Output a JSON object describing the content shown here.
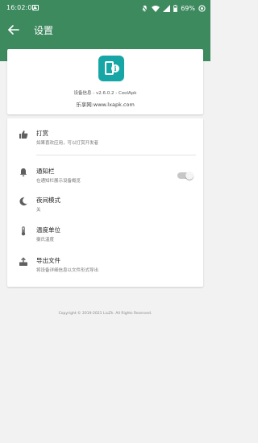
{
  "status_bar": {
    "time": "16:02:07",
    "battery": "69%",
    "icons": [
      "image-icon",
      "bell-off-icon",
      "wifi-icon",
      "signal-icon",
      "battery-icon",
      "sync-icon"
    ]
  },
  "app_bar": {
    "title": "设置",
    "back_icon": "arrow-left-icon"
  },
  "header": {
    "version": "设备信息 - v2.6.0.2 - CoolApk",
    "site": "乐享网:www.lxapk.com"
  },
  "settings": [
    {
      "title": "打赏",
      "subtitle": "如果喜欢应用，可以打赏开发者",
      "icon": "thumb-up-icon"
    },
    {
      "title": "通知栏",
      "subtitle": "在通知栏展示设备概览",
      "icon": "bell-icon",
      "toggle": false
    },
    {
      "title": "夜间模式",
      "subtitle": "关",
      "icon": "moon-icon"
    },
    {
      "title": "温度单位",
      "subtitle": "摄氏温度",
      "icon": "thermometer-icon"
    },
    {
      "title": "导出文件",
      "subtitle": "将设备详细信息以文件形式导出",
      "icon": "export-icon"
    }
  ],
  "footer": {
    "copyright": "Copyright © 2019-2021 LiuZh. All Rights Reserved."
  },
  "colors": {
    "primary": "#3d8a5f",
    "logo": "#16a6a5",
    "background": "#f2f2f2"
  }
}
